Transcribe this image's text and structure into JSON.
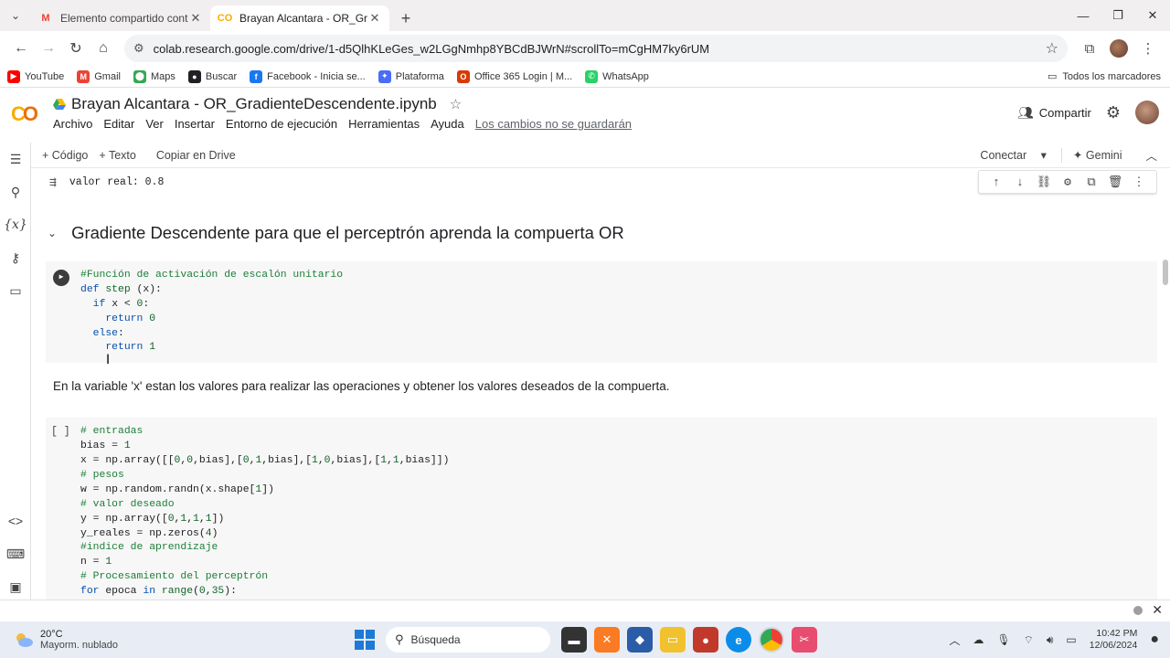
{
  "browser": {
    "tabs": [
      {
        "title": "Elemento compartido contigo",
        "icon": "gmail-icon",
        "active": false
      },
      {
        "title": "Brayan Alcantara - OR_Gradiente",
        "icon": "colab-icon",
        "active": true
      }
    ],
    "url": "colab.research.google.com/drive/1-d5QlhKLeGes_w2LGgNmhp8YBCdBJWrN#scrollTo=mCgHM7ky6rUM",
    "bookmarks": [
      {
        "label": "YouTube",
        "color": "#ff0000",
        "glyph": "▶"
      },
      {
        "label": "Gmail",
        "color": "#ea4335",
        "glyph": "M"
      },
      {
        "label": "Maps",
        "color": "#34a853",
        "glyph": "⬤"
      },
      {
        "label": "Buscar",
        "color": "#202124",
        "glyph": "●"
      },
      {
        "label": "Facebook - Inicia se...",
        "color": "#1877f2",
        "glyph": "f"
      },
      {
        "label": "Plataforma",
        "color": "#4a6cf7",
        "glyph": "✦"
      },
      {
        "label": "Office 365 Login | M...",
        "color": "#d83b01",
        "glyph": "O"
      },
      {
        "label": "WhatsApp",
        "color": "#25d366",
        "glyph": "✆"
      }
    ],
    "all_bookmarks": "Todos los marcadores"
  },
  "colab": {
    "logo": "CO",
    "title": "Brayan Alcantara - OR_GradienteDescendente.ipynb",
    "menu": [
      "Archivo",
      "Editar",
      "Ver",
      "Insertar",
      "Entorno de ejecución",
      "Herramientas",
      "Ayuda"
    ],
    "unsaved": "Los cambios no se guardarán",
    "share": "Compartir",
    "toolbar": {
      "code": "+ Código",
      "text": "+ Texto",
      "copy": "Copiar en Drive",
      "connect": "Conectar",
      "gemini": "Gemini"
    }
  },
  "notebook": {
    "prev_output": "valor real:  0.8",
    "heading": "Gradiente Descendente para que el perceptrón aprenda la compuerta OR",
    "step_cell": [
      [
        {
          "t": "#Función de activación de escalón unitario",
          "c": "cm"
        }
      ],
      [
        {
          "t": "def ",
          "c": "kw"
        },
        {
          "t": "step",
          "c": "nm"
        },
        {
          "t": " (x):",
          "c": "pl"
        }
      ],
      [
        {
          "t": "  if ",
          "c": "kw"
        },
        {
          "t": "x < ",
          "c": "pl"
        },
        {
          "t": "0",
          "c": "nm"
        },
        {
          "t": ":",
          "c": "pl"
        }
      ],
      [
        {
          "t": "    return ",
          "c": "kw"
        },
        {
          "t": "0",
          "c": "nm"
        }
      ],
      [
        {
          "t": "  else",
          "c": "kw"
        },
        {
          "t": ":",
          "c": "pl"
        }
      ],
      [
        {
          "t": "    return ",
          "c": "kw"
        },
        {
          "t": "1",
          "c": "nm"
        }
      ]
    ],
    "text_cell": "En la variable 'x' estan los valores para realizar las operaciones y obtener los valores deseados de la compuerta.",
    "exec_count": "[ ]",
    "main_cell": [
      [
        {
          "t": "# entradas",
          "c": "cm"
        }
      ],
      [
        {
          "t": "bias = ",
          "c": "pl"
        },
        {
          "t": "1",
          "c": "nm"
        }
      ],
      [
        {
          "t": "x = np.array([[",
          "c": "pl"
        },
        {
          "t": "0",
          "c": "nm"
        },
        {
          "t": ",",
          "c": "pl"
        },
        {
          "t": "0",
          "c": "nm"
        },
        {
          "t": ",bias],[",
          "c": "pl"
        },
        {
          "t": "0",
          "c": "nm"
        },
        {
          "t": ",",
          "c": "pl"
        },
        {
          "t": "1",
          "c": "nm"
        },
        {
          "t": ",bias],[",
          "c": "pl"
        },
        {
          "t": "1",
          "c": "nm"
        },
        {
          "t": ",",
          "c": "pl"
        },
        {
          "t": "0",
          "c": "nm"
        },
        {
          "t": ",bias],[",
          "c": "pl"
        },
        {
          "t": "1",
          "c": "nm"
        },
        {
          "t": ",",
          "c": "pl"
        },
        {
          "t": "1",
          "c": "nm"
        },
        {
          "t": ",bias]])",
          "c": "pl"
        }
      ],
      [
        {
          "t": "# pesos",
          "c": "cm"
        }
      ],
      [
        {
          "t": "w = np.random.randn(x.shape[",
          "c": "pl"
        },
        {
          "t": "1",
          "c": "nm"
        },
        {
          "t": "])",
          "c": "pl"
        }
      ],
      [
        {
          "t": "# valor deseado",
          "c": "cm"
        }
      ],
      [
        {
          "t": "y = np.array([",
          "c": "pl"
        },
        {
          "t": "0",
          "c": "nm"
        },
        {
          "t": ",",
          "c": "pl"
        },
        {
          "t": "1",
          "c": "nm"
        },
        {
          "t": ",",
          "c": "pl"
        },
        {
          "t": "1",
          "c": "nm"
        },
        {
          "t": ",",
          "c": "pl"
        },
        {
          "t": "1",
          "c": "nm"
        },
        {
          "t": "])",
          "c": "pl"
        }
      ],
      [
        {
          "t": "y_reales = np.zeros(",
          "c": "pl"
        },
        {
          "t": "4",
          "c": "nm"
        },
        {
          "t": ")",
          "c": "pl"
        }
      ],
      [
        {
          "t": "#indice de aprendizaje",
          "c": "cm"
        }
      ],
      [
        {
          "t": "n = ",
          "c": "pl"
        },
        {
          "t": "1",
          "c": "nm"
        }
      ],
      [
        {
          "t": "# Procesamiento del perceptrón",
          "c": "cm"
        }
      ],
      [
        {
          "t": "for ",
          "c": "kw"
        },
        {
          "t": "epoca ",
          "c": "pl"
        },
        {
          "t": "in ",
          "c": "kw"
        },
        {
          "t": "range",
          "c": "nm"
        },
        {
          "t": "(",
          "c": "pl"
        },
        {
          "t": "0",
          "c": "nm"
        },
        {
          "t": ",",
          "c": "pl"
        },
        {
          "t": "35",
          "c": "nm"
        },
        {
          "t": "):",
          "c": "pl"
        }
      ]
    ]
  },
  "taskbar": {
    "temp": "20°C",
    "weather": "Mayorm. nublado",
    "search": "Búsqueda",
    "time": "10:42 PM",
    "date": "12/06/2024"
  }
}
